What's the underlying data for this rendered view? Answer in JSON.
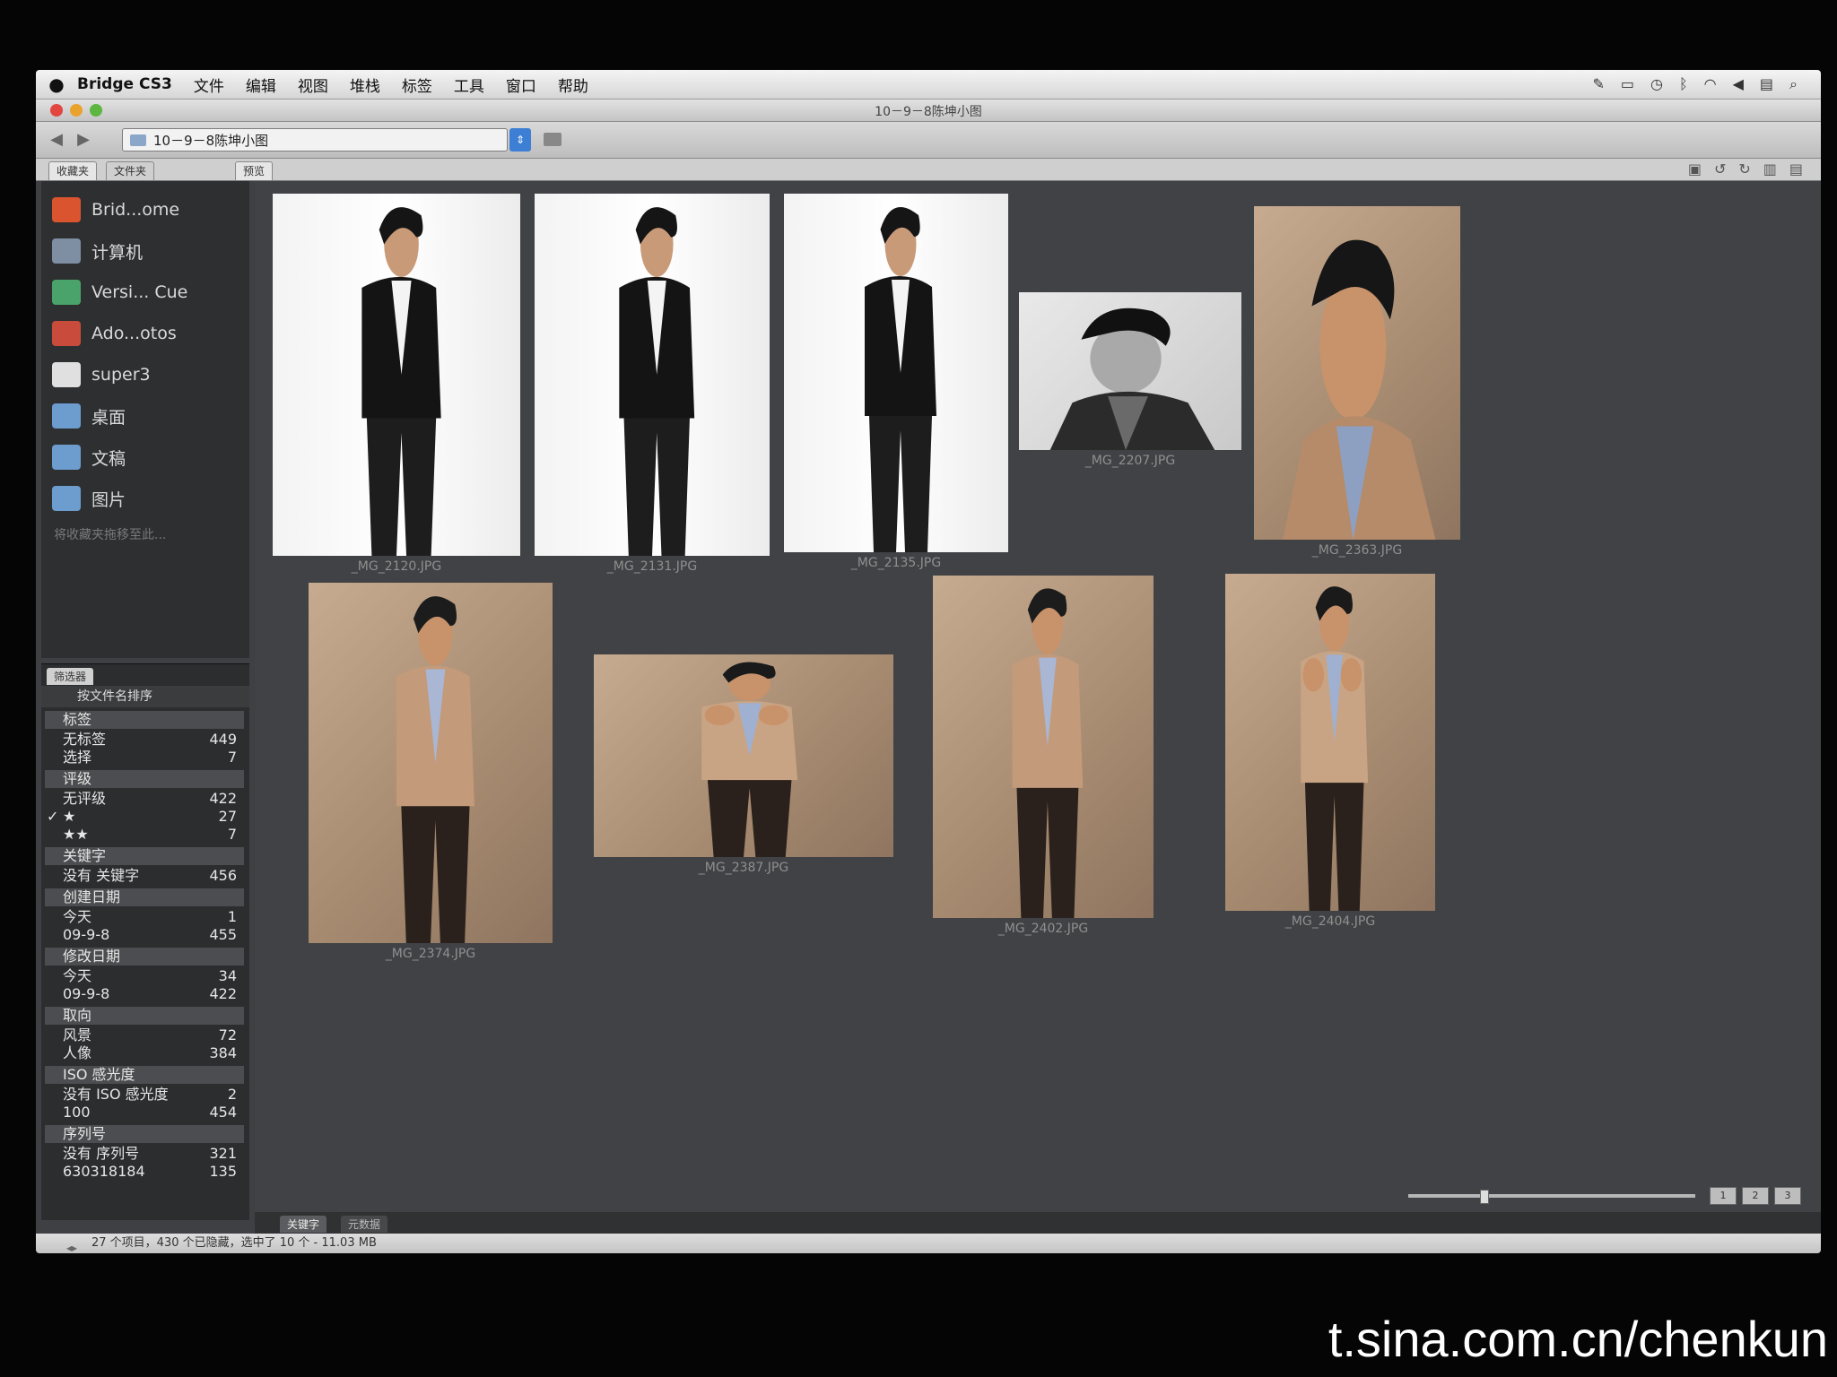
{
  "menubar": {
    "app_name": "Bridge CS3",
    "menus": [
      "文件",
      "编辑",
      "视图",
      "堆栈",
      "标签",
      "工具",
      "窗口",
      "帮助"
    ],
    "tray_icons": [
      "script-icon",
      "display-icon",
      "time-machine-icon",
      "bluetooth-icon",
      "wifi-icon",
      "volume-icon",
      "flag-icon",
      "spotlight-icon"
    ]
  },
  "window": {
    "title": "10－9－8陈坤小图",
    "path": "10－9－8陈坤小图"
  },
  "tabs": {
    "favorites": "收藏夹",
    "folders": "文件夹",
    "preview": "预览",
    "filter": "筛选器",
    "keywords": "关键字",
    "metadata": "元数据"
  },
  "favorites": {
    "items": [
      {
        "label": "Brid...ome",
        "icon": "bridge-home-icon",
        "color": "#d9542f"
      },
      {
        "label": "计算机",
        "icon": "computer-icon",
        "color": "#7f8fa3"
      },
      {
        "label": "Versi... Cue",
        "icon": "version-cue-icon",
        "color": "#4aa36a"
      },
      {
        "label": "Ado...otos",
        "icon": "adobe-photos-icon",
        "color": "#c94b3b"
      },
      {
        "label": "super3",
        "icon": "home-folder-icon",
        "color": "#e0e0e0"
      },
      {
        "label": "桌面",
        "icon": "desktop-folder-icon",
        "color": "#6d9ccf"
      },
      {
        "label": "文稿",
        "icon": "documents-folder-icon",
        "color": "#6d9ccf"
      },
      {
        "label": "图片",
        "icon": "pictures-folder-icon",
        "color": "#6d9ccf"
      }
    ],
    "hint": "将收藏夹拖移至此..."
  },
  "filter": {
    "sort_label": "按文件名排序",
    "groups": [
      {
        "name": "标签",
        "rows": [
          {
            "label": "无标签",
            "count": "449"
          },
          {
            "label": "选择",
            "count": "7"
          }
        ]
      },
      {
        "name": "评级",
        "rows": [
          {
            "label": "无评级",
            "count": "422"
          },
          {
            "label": "★",
            "count": "27",
            "checked": "✓"
          },
          {
            "label": "★★",
            "count": "7"
          }
        ]
      },
      {
        "name": "关键字",
        "rows": [
          {
            "label": "没有 关键字",
            "count": "456"
          }
        ]
      },
      {
        "name": "创建日期",
        "rows": [
          {
            "label": "今天",
            "count": "1"
          },
          {
            "label": "09-9-8",
            "count": "455"
          }
        ]
      },
      {
        "name": "修改日期",
        "rows": [
          {
            "label": "今天",
            "count": "34"
          },
          {
            "label": "09-9-8",
            "count": "422"
          }
        ]
      },
      {
        "name": "取向",
        "rows": [
          {
            "label": "风景",
            "count": "72"
          },
          {
            "label": "人像",
            "count": "384"
          }
        ]
      },
      {
        "name": "ISO 感光度",
        "rows": [
          {
            "label": "没有 ISO 感光度",
            "count": "2"
          },
          {
            "label": "100",
            "count": "454"
          }
        ]
      },
      {
        "name": "序列号",
        "rows": [
          {
            "label": "没有 序列号",
            "count": "321"
          },
          {
            "label": "630318184",
            "count": "135"
          }
        ]
      }
    ]
  },
  "thumbnails": [
    {
      "file": "_MG_2120.JPG",
      "bg": "white",
      "pose": "tux"
    },
    {
      "file": "_MG_2131.JPG",
      "bg": "white",
      "pose": "tux"
    },
    {
      "file": "_MG_2135.JPG",
      "bg": "white",
      "pose": "tux"
    },
    {
      "file": "_MG_2207.JPG",
      "bg": "bw",
      "pose": "face"
    },
    {
      "file": "_MG_2363.JPG",
      "bg": "tan",
      "pose": "close"
    },
    {
      "file": "_MG_2374.JPG",
      "bg": "tan",
      "pose": "jacket"
    },
    {
      "file": "_MG_2387.JPG",
      "bg": "tan",
      "pose": "fist"
    },
    {
      "file": "_MG_2402.JPG",
      "bg": "tan",
      "pose": "jacket"
    },
    {
      "file": "_MG_2404.JPG",
      "bg": "tan",
      "pose": "fist"
    }
  ],
  "status": {
    "text": "27 个项目，430 个已隐藏，选中了 10 个 - 11.03 MB"
  },
  "view_buttons": [
    "1",
    "2",
    "3"
  ],
  "watermark": "t.sina.com.cn/chenkun"
}
